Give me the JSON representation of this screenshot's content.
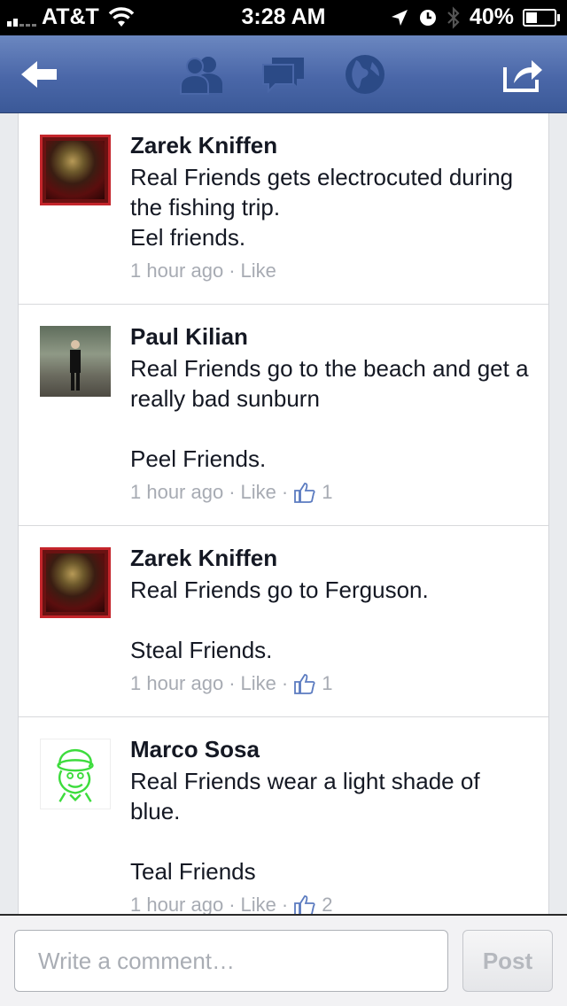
{
  "status_bar": {
    "carrier": "AT&T",
    "time": "3:28 AM",
    "battery": "40%",
    "battery_level": 0.4
  },
  "nav": {
    "icons": [
      "back-arrow-icon",
      "friends-icon",
      "messages-icon",
      "globe-icon",
      "share-icon"
    ]
  },
  "comments": [
    {
      "author": "Zarek Kniffen",
      "text": "Real Friends gets electrocuted during the fishing trip.\nEel friends.",
      "time": "1 hour ago",
      "like_label": "Like",
      "likes": ""
    },
    {
      "author": "Paul Kilian",
      "text": "Real Friends go to the beach and get a really bad sunburn\n\nPeel Friends.",
      "time": "1 hour ago",
      "like_label": "Like",
      "likes": "1"
    },
    {
      "author": "Zarek Kniffen",
      "text": "Real Friends go to Ferguson.\n\nSteal Friends.",
      "time": "1 hour ago",
      "like_label": "Like",
      "likes": "1"
    },
    {
      "author": "Marco Sosa",
      "text": "Real Friends wear a light shade of blue.\n\nTeal Friends",
      "time": "1 hour ago",
      "like_label": "Like",
      "likes": "2"
    }
  ],
  "composer": {
    "placeholder": "Write a comment…",
    "value": "",
    "post_label": "Post"
  },
  "colors": {
    "nav_blue": "#4a67a8",
    "text": "#141823",
    "meta_gray": "#a7abb3",
    "like_blue": "#5b7bc0"
  }
}
